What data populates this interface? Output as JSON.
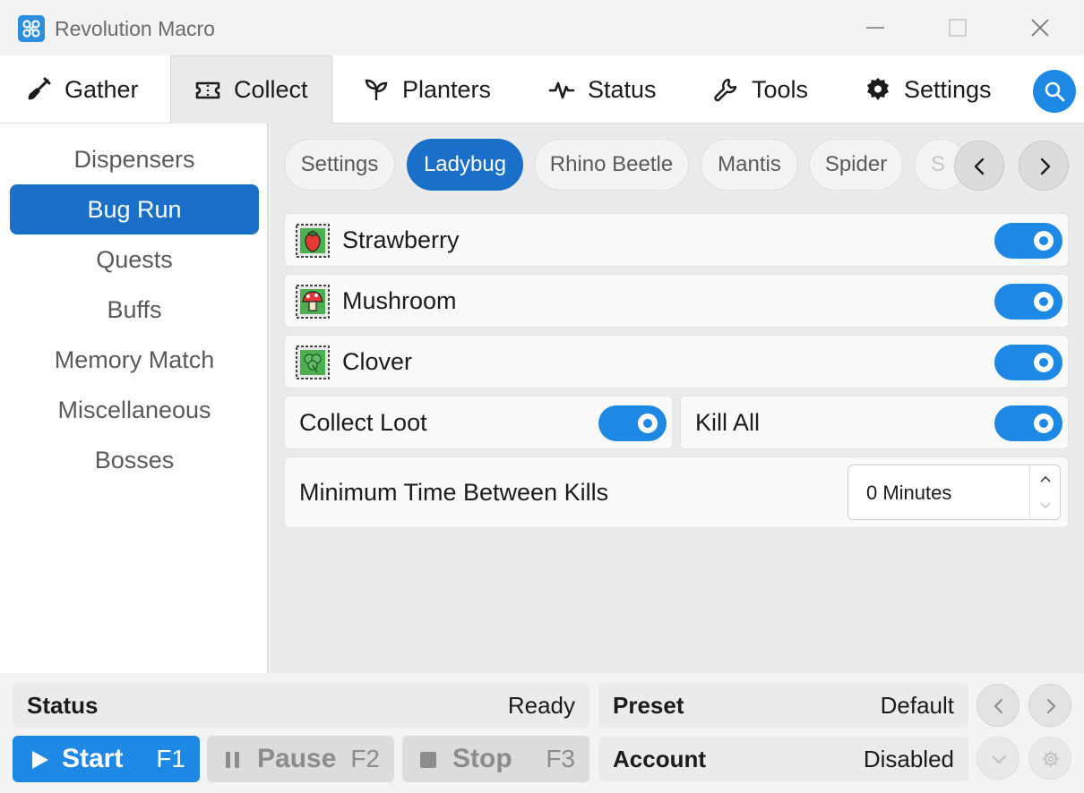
{
  "window": {
    "title": "Revolution Macro",
    "logo_icon": "revolution-logo",
    "controls": [
      "minimize-icon",
      "maximize-icon",
      "close-icon"
    ]
  },
  "tabs": [
    {
      "label": "Gather",
      "icon": "shovel-icon"
    },
    {
      "label": "Collect",
      "icon": "ticket-icon",
      "active": true
    },
    {
      "label": "Planters",
      "icon": "sprout-icon"
    },
    {
      "label": "Status",
      "icon": "pulse-icon"
    },
    {
      "label": "Tools",
      "icon": "wrench-icon"
    },
    {
      "label": "Settings",
      "icon": "gear-icon"
    }
  ],
  "sidebar": {
    "items": [
      {
        "label": "Dispensers"
      },
      {
        "label": "Bug Run",
        "active": true
      },
      {
        "label": "Quests"
      },
      {
        "label": "Buffs"
      },
      {
        "label": "Memory Match"
      },
      {
        "label": "Miscellaneous"
      },
      {
        "label": "Bosses"
      }
    ]
  },
  "subtabs": [
    {
      "label": "Settings"
    },
    {
      "label": "Ladybug",
      "active": true
    },
    {
      "label": "Rhino Beetle"
    },
    {
      "label": "Mantis"
    },
    {
      "label": "Spider"
    },
    {
      "label": "S"
    }
  ],
  "fields": [
    {
      "label": "Strawberry",
      "icon": "strawberry-icon",
      "enabled": true
    },
    {
      "label": "Mushroom",
      "icon": "mushroom-icon",
      "enabled": true
    },
    {
      "label": "Clover",
      "icon": "clover-icon",
      "enabled": true
    }
  ],
  "options": {
    "collect_loot": {
      "label": "Collect Loot",
      "enabled": true
    },
    "kill_all": {
      "label": "Kill All",
      "enabled": true
    }
  },
  "min_time": {
    "label": "Minimum Time Between Kills",
    "value": "0 Minutes"
  },
  "bottom": {
    "status_key": "Status",
    "status_value": "Ready",
    "preset_key": "Preset",
    "preset_value": "Default",
    "account_key": "Account",
    "account_value": "Disabled",
    "start_label": "Start",
    "start_key": "F1",
    "pause_label": "Pause",
    "pause_key": "F2",
    "stop_label": "Stop",
    "stop_key": "F3"
  },
  "colors": {
    "accent": "#1e88e5",
    "active_nav": "#1a6fc9"
  }
}
